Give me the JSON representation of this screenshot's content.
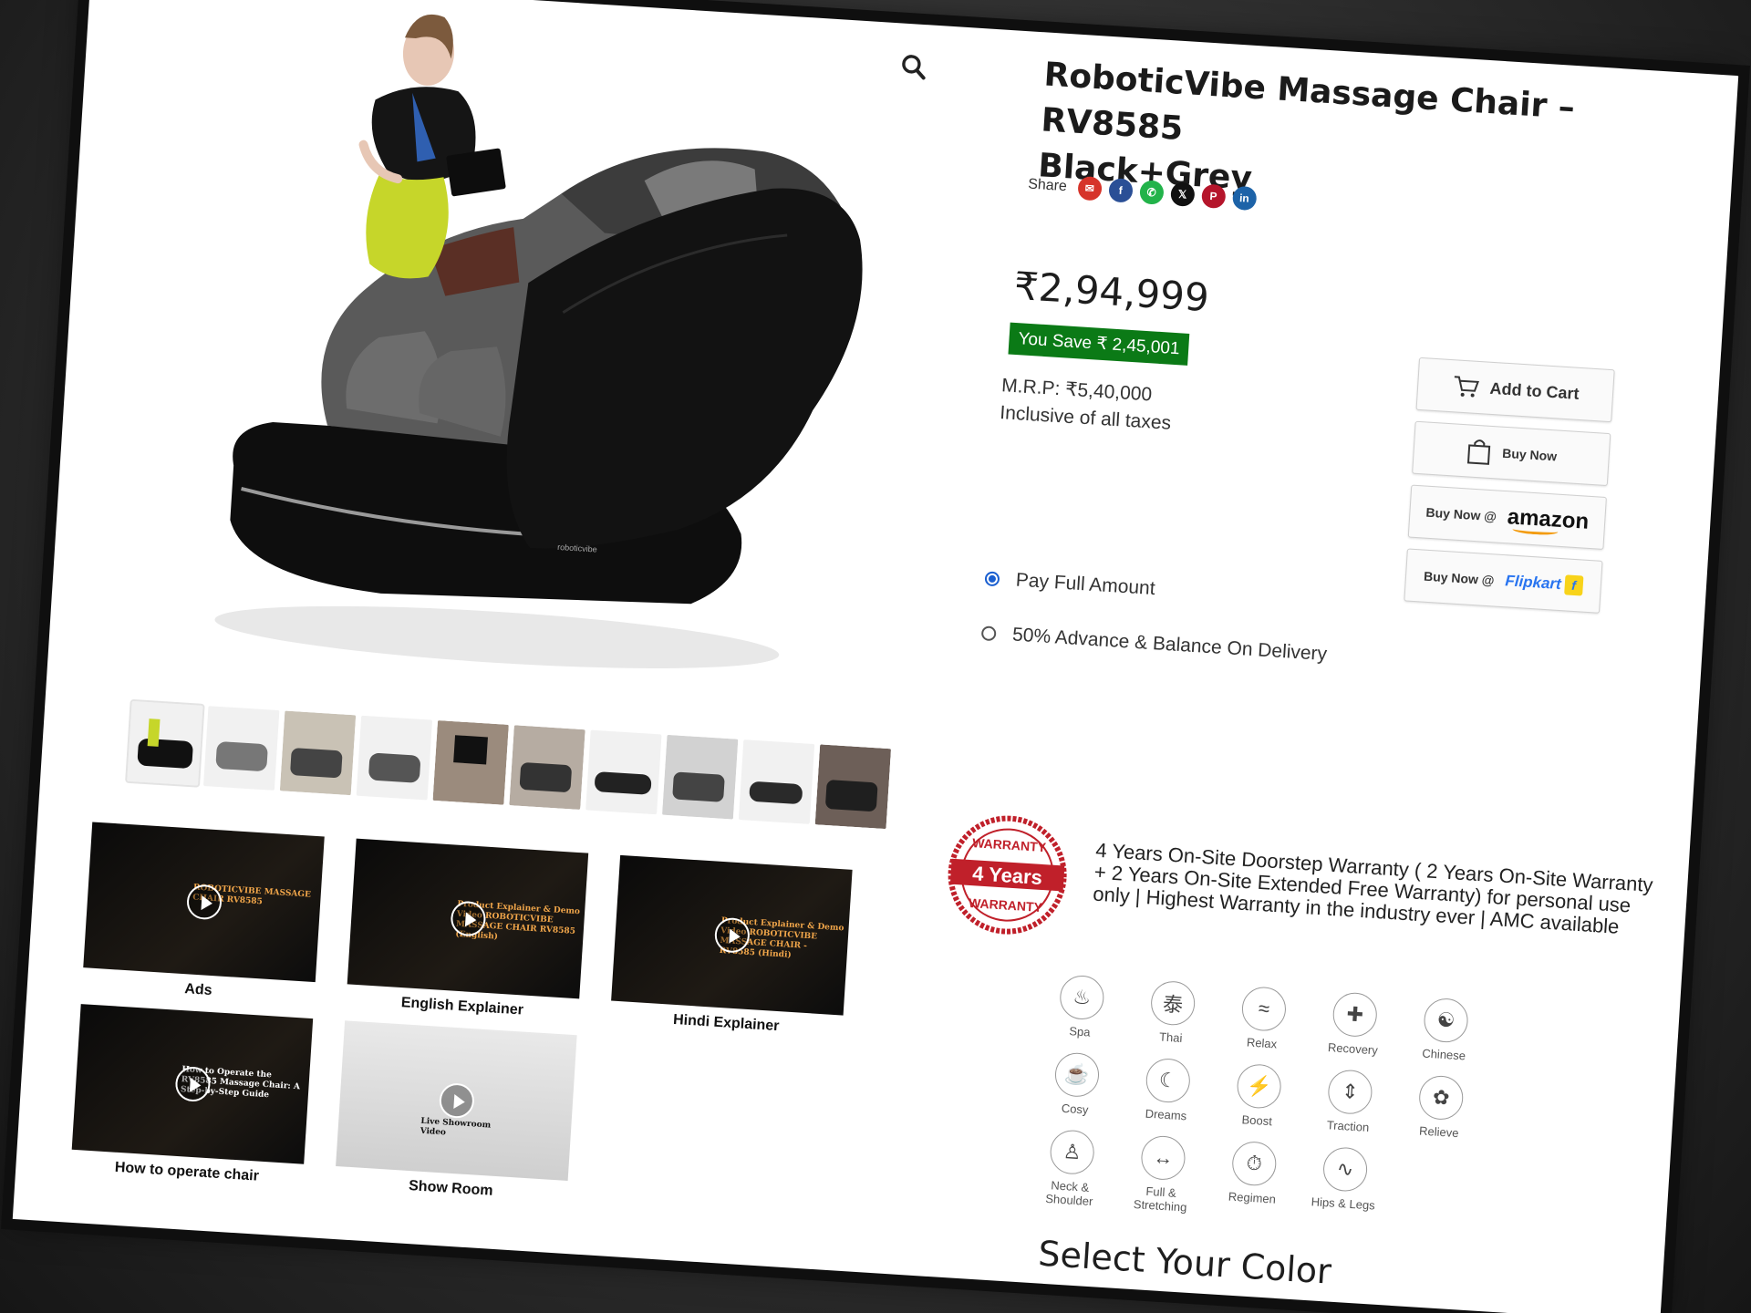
{
  "product": {
    "title_line1": "RoboticVibe Massage Chair – RV8585",
    "title_line2": "Black+Grey",
    "price": "₹2,94,999",
    "you_save": "You Save ₹ 2,45,001",
    "mrp": "M.R.P: ₹5,40,000",
    "tax_note": "Inclusive of all taxes"
  },
  "share": {
    "label": "Share",
    "icons": [
      {
        "name": "email-icon",
        "glyph": "✉",
        "color": "#d6342a"
      },
      {
        "name": "facebook-icon",
        "glyph": "f",
        "color": "#2a4f96"
      },
      {
        "name": "whatsapp-icon",
        "glyph": "✆",
        "color": "#22b34a"
      },
      {
        "name": "x-icon",
        "glyph": "𝕏",
        "color": "#111111"
      },
      {
        "name": "pinterest-icon",
        "glyph": "P",
        "color": "#b5152b"
      },
      {
        "name": "linkedin-icon",
        "glyph": "in",
        "color": "#1d63a8"
      }
    ]
  },
  "buttons": {
    "add_to_cart": "Add to Cart",
    "buy_now": "Buy Now",
    "buy_now_at": "Buy Now @",
    "amazon": "amazon",
    "flipkart": "Flipkart"
  },
  "payment": {
    "options": [
      {
        "label": "Pay Full Amount",
        "checked": true
      },
      {
        "label": "50% Advance & Balance On Delivery",
        "checked": false
      }
    ]
  },
  "warranty": {
    "badge_top": "WARRANTY",
    "badge_main": "4 Years",
    "badge_bottom": "WARRANTY",
    "text": "4 Years On-Site Doorstep Warranty ( 2 Years On-Site Warranty + 2 Years On-Site Extended Free Warranty) for personal use only | Highest Warranty in the industry ever | AMC available"
  },
  "features": [
    {
      "label": "Spa",
      "icon": "spa-icon",
      "glyph": "♨"
    },
    {
      "label": "Thai",
      "icon": "thai-icon",
      "glyph": "泰"
    },
    {
      "label": "Relax",
      "icon": "relax-icon",
      "glyph": "≈"
    },
    {
      "label": "Recovery",
      "icon": "recovery-icon",
      "glyph": "✚"
    },
    {
      "label": "Chinese",
      "icon": "yin-yang-icon",
      "glyph": "☯"
    },
    {
      "label": "Cosy",
      "icon": "cosy-icon",
      "glyph": "☕"
    },
    {
      "label": "Dreams",
      "icon": "dreams-icon",
      "glyph": "☾"
    },
    {
      "label": "Boost",
      "icon": "boost-icon",
      "glyph": "⚡"
    },
    {
      "label": "Traction",
      "icon": "traction-icon",
      "glyph": "⇕"
    },
    {
      "label": "Relieve",
      "icon": "relieve-icon",
      "glyph": "✿"
    },
    {
      "label": "Neck & Shoulder",
      "icon": "neck-shoulder-icon",
      "glyph": "♙"
    },
    {
      "label": "Full & Stretching",
      "icon": "stretching-icon",
      "glyph": "↔"
    },
    {
      "label": "Regimen",
      "icon": "regimen-icon",
      "glyph": "⏱"
    },
    {
      "label": "Hips & Legs",
      "icon": "hips-legs-icon",
      "glyph": "∿"
    }
  ],
  "videos": [
    {
      "label": "Ads",
      "caption": "ROBOTICVIBE MASSAGE CHAIR RV8585"
    },
    {
      "label": "English Explainer",
      "caption": "Product Explainer & Demo Video ROBOTICVIBE MASSAGE CHAIR RV8585 (English)"
    },
    {
      "label": "Hindi Explainer",
      "caption": "Product Explainer & Demo Video ROBOTICVIBE MASSAGE CHAIR - RV8585 (Hindi)"
    },
    {
      "label": "How to operate chair",
      "caption": "How to Operate the RV8585 Massage Chair: A Step-by-Step Guide"
    },
    {
      "label": "Show Room",
      "caption": "Live Showroom Video"
    }
  ],
  "brand_mark": "roboticvibe",
  "select_color": "Select Your Color",
  "colors": {
    "save_green": "#0b7a16",
    "radio_blue": "#1a5fd0",
    "warranty_red": "#c0202a"
  }
}
